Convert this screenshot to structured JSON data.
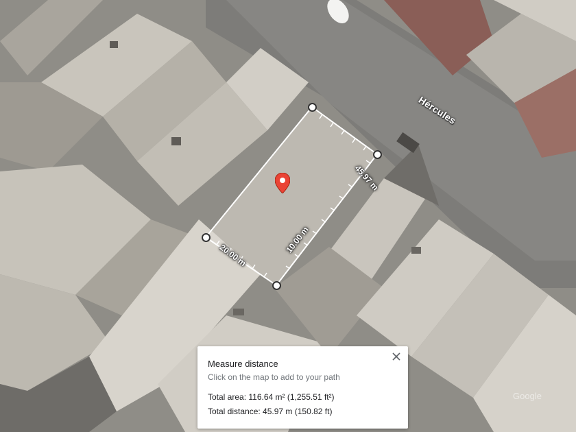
{
  "map": {
    "street_name": "Hércules",
    "watermark": "Google",
    "pin_color": "#ea4335",
    "measure_line_color": "#ffffff"
  },
  "measurement": {
    "segments": [
      {
        "label": "45.97 m"
      },
      {
        "label": "20.00 m"
      },
      {
        "label": "10.00 m"
      }
    ]
  },
  "panel": {
    "title": "Measure distance",
    "hint": "Click on the map to add to your path",
    "total_area": "Total area: 116.64 m² (1,255.51 ft²)",
    "total_distance": "Total distance: 45.97 m (150.82 ft)",
    "close_icon": "close-icon"
  }
}
